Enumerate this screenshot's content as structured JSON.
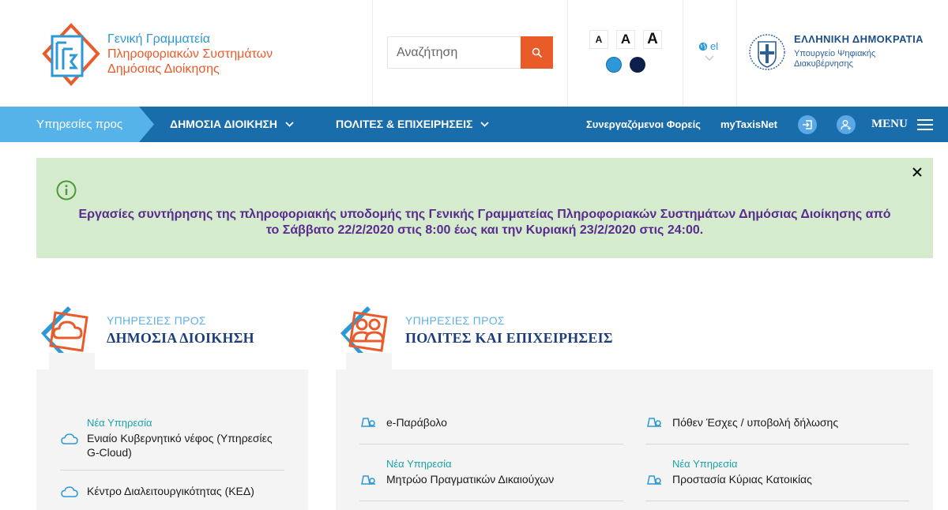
{
  "header": {
    "org_line1": "Γενική Γραμματεία",
    "org_line2": "Πληροφοριακών Συστημάτων",
    "org_line3": "Δημόσιας Διοίκησης",
    "search": {
      "placeholder": "Αναζήτηση"
    },
    "font_size_labels": [
      "A",
      "A",
      "A"
    ],
    "contrast_colors": [
      "#2c98d6",
      "#0b1f4a"
    ],
    "language": "el",
    "gov_title": "ΕΛΛΗΝΙΚΗ ΔΗΜΟΚΡΑΤΙΑ",
    "gov_sub_line1": "Υπουργείο Ψηφιακής",
    "gov_sub_line2": "Διακυβέρνησης"
  },
  "nav": {
    "services_label": "Υπηρεσίες προς",
    "public_admin": "ΔΗΜΟΣΙΑ ΔΙΟΙΚΗΣΗ",
    "citizens": "ΠΟΛΙΤΕΣ & ΕΠΙΧΕΙΡΗΣΕΙΣ",
    "partners": "Συνεργαζόμενοι Φορείς",
    "taxisnet": "myTaxisNet",
    "menu": "MENU"
  },
  "alert": {
    "message": "Εργασίες συντήρησης της πληροφοριακής υποδομής της Γενικής Γραμματείας Πληροφοριακών Συστημάτων Δημόσιας Διοίκησης από το Σάββατο 22/2/2020 στις 8:00 έως και την Κυριακή 23/2/2020 στις 24:00."
  },
  "sections": {
    "public": {
      "kicker": "ΥΠΗΡΕΣΙΕΣ ΠΡΟΣ",
      "title": "ΔΗΜΟΣΙΑ ΔΙΟΙΚΗΣΗ",
      "items": [
        {
          "badge": "Νέα Υπηρεσία",
          "name": "Ενιαίο Κυβερνητικό νέφος (Υπηρεσίες G-Cloud)"
        },
        {
          "badge": "",
          "name": "Κέντρο Διαλειτουργικότητας (ΚΕΔ)"
        }
      ]
    },
    "citizens": {
      "kicker": "ΥΠΗΡΕΣΙΕΣ ΠΡΟΣ",
      "title": "ΠΟΛΙΤΕΣ ΚΑΙ ΕΠΙΧΕΙΡΗΣΕΙΣ",
      "items": [
        {
          "badge": "",
          "name": "e-Παράβολο"
        },
        {
          "badge": "",
          "name": "Πόθεν Έσχες / υποβολή δήλωσης"
        },
        {
          "badge": "Νέα Υπηρεσία",
          "name": "Μητρώο Πραγματικών Δικαιούχων"
        },
        {
          "badge": "Νέα Υπηρεσία",
          "name": "Προστασία Κύριας Κατοικίας"
        }
      ]
    }
  },
  "colors": {
    "blue": "#2c98d6",
    "orange": "#ea5b2a",
    "nav": "#1a6dab",
    "alert_bg": "#d5ebce",
    "alert_text": "#5a2c8f",
    "badge": "#1aa3a8"
  }
}
